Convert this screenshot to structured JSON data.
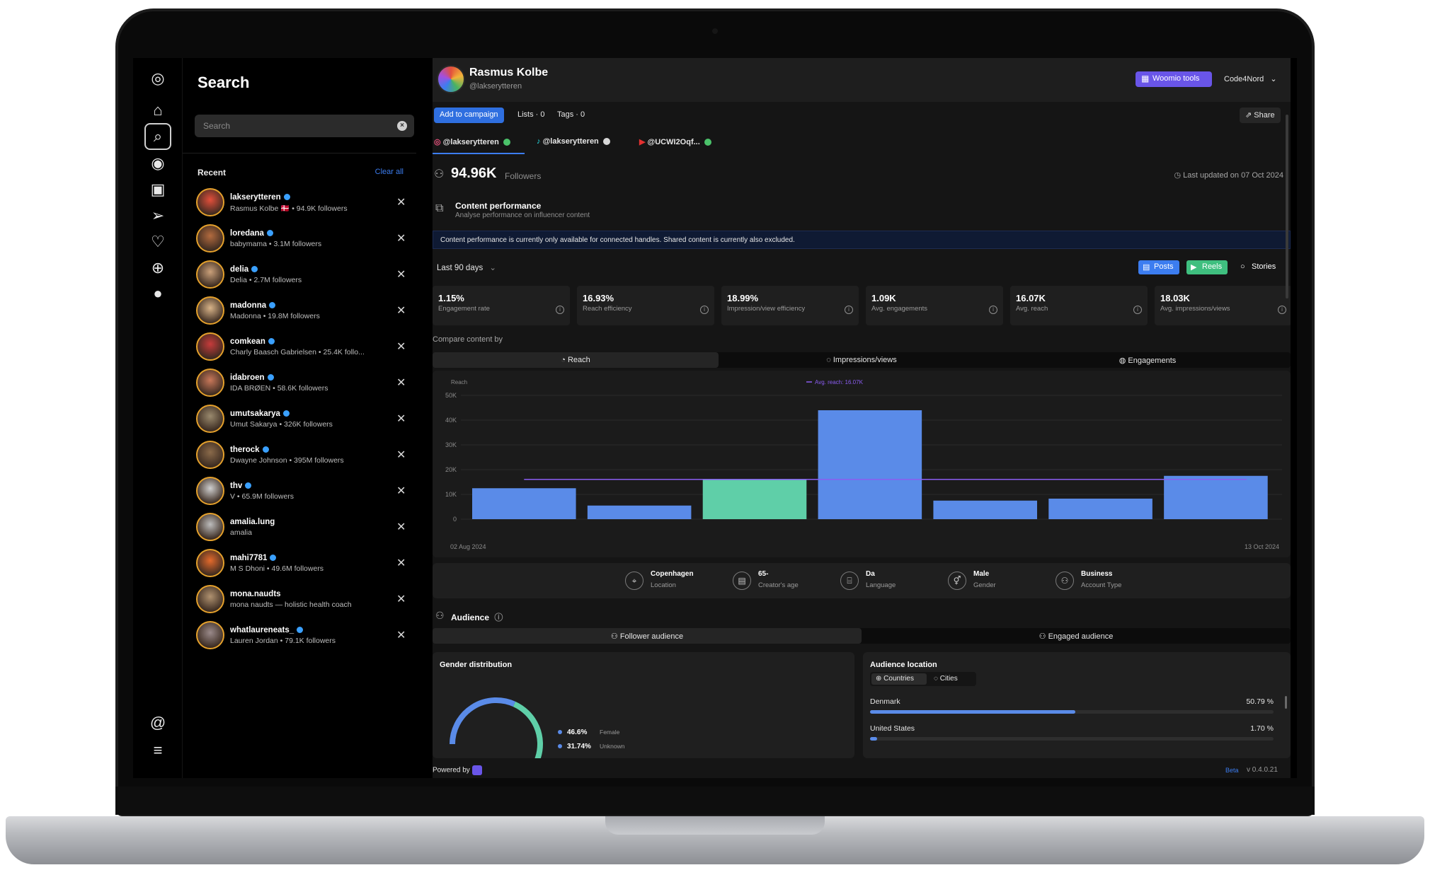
{
  "search": {
    "title": "Search",
    "placeholder": "Search",
    "recent_label": "Recent",
    "clear_all": "Clear all",
    "recent": [
      {
        "name": "lakserytteren",
        "sub": "Rasmus Kolbe 🇩🇰 • 94.9K followers",
        "verified": true,
        "color": "#e34f3b"
      },
      {
        "name": "loredana",
        "sub": "babymama • 3.1M followers",
        "verified": true,
        "color": "#b36b3f"
      },
      {
        "name": "delia",
        "sub": "Delia • 2.7M followers",
        "verified": true,
        "color": "#caa07a"
      },
      {
        "name": "madonna",
        "sub": "Madonna • 19.8M followers",
        "verified": true,
        "color": "#d9b489"
      },
      {
        "name": "comkean",
        "sub": "Charly Baasch Gabrielsen • 25.4K follo...",
        "verified": true,
        "color": "#c63b3b"
      },
      {
        "name": "idabroen",
        "sub": "IDA BRØEN • 58.6K followers",
        "verified": true,
        "color": "#c9785a"
      },
      {
        "name": "umutsakarya",
        "sub": "Umut Sakarya • 326K followers",
        "verified": true,
        "color": "#9a8a6e"
      },
      {
        "name": "therock",
        "sub": "Dwayne Johnson • 395M followers",
        "verified": true,
        "color": "#8a6a4a"
      },
      {
        "name": "thv",
        "sub": "V • 65.9M followers",
        "verified": true,
        "color": "#d0d0d0"
      },
      {
        "name": "amalia.lung",
        "sub": "amalia",
        "verified": false,
        "color": "#bdbdbd"
      },
      {
        "name": "mahi7781",
        "sub": "M S Dhoni • 49.6M followers",
        "verified": true,
        "color": "#e46a2c"
      },
      {
        "name": "mona.naudts",
        "sub": "mona naudts — holistic health coach",
        "verified": false,
        "color": "#b09270"
      },
      {
        "name": "whatlaureneats_",
        "sub": "Lauren Jordan • 79.1K followers",
        "verified": true,
        "color": "#9a8a8a"
      }
    ]
  },
  "profile": {
    "name": "Rasmus Kolbe",
    "handle": "@lakserytteren",
    "woomio_tools": "Woomio tools",
    "org": "Code4Nord"
  },
  "toolbar": {
    "add_campaign": "Add to campaign",
    "lists": "Lists · 0",
    "tags": "Tags · 0",
    "share": "Share"
  },
  "handles": [
    {
      "label": "@lakserytteren",
      "dot": "#4bc26a"
    },
    {
      "label": "@lakserytteren",
      "dot": "#d8d8d8"
    },
    {
      "label": "@UCWI2Oqf...",
      "dot": "#4bc26a"
    }
  ],
  "stats": {
    "followers": "94.96K",
    "followers_label": "Followers",
    "last_updated": "Last updated on 07 Oct 2024"
  },
  "content_performance": {
    "title": "Content performance",
    "subtitle": "Analyse performance on influencer content",
    "banner": "Content performance is currently only available for connected handles. Shared content is currently also excluded.",
    "period": "Last 90 days",
    "types": [
      "Posts",
      "Reels",
      "Stories"
    ]
  },
  "metrics": [
    {
      "value": "1.15%",
      "label": "Engagement rate"
    },
    {
      "value": "16.93%",
      "label": "Reach efficiency"
    },
    {
      "value": "18.99%",
      "label": "Impression/view efficiency"
    },
    {
      "value": "1.09K",
      "label": "Avg. engagements"
    },
    {
      "value": "16.07K",
      "label": "Avg. reach"
    },
    {
      "value": "18.03K",
      "label": "Avg. impressions/views"
    }
  ],
  "compare": {
    "label": "Compare content by",
    "tabs": [
      "Reach",
      "Impressions/views",
      "Engagements"
    ]
  },
  "chart_data": {
    "type": "bar",
    "ylabel": "Reach",
    "ylim": [
      0,
      50000
    ],
    "yticks": [
      "0",
      "10K",
      "20K",
      "30K",
      "40K",
      "50K"
    ],
    "x_start": "02 Aug 2024",
    "x_end": "13 Oct 2024",
    "values": [
      12500,
      5500,
      16000,
      44000,
      7500,
      8300,
      17500
    ],
    "highlight_index": 2,
    "avg_label": "Avg. reach: 16.07K",
    "avg_value": 16070,
    "bar_color": "#5a8be8",
    "highlight_color": "#5fcfa8",
    "avg_color": "#8a5cf0"
  },
  "demographics": [
    {
      "value": "Copenhagen",
      "label": "Location"
    },
    {
      "value": "65-",
      "label": "Creator's age"
    },
    {
      "value": "Da",
      "label": "Language"
    },
    {
      "value": "Male",
      "label": "Gender"
    },
    {
      "value": "Business",
      "label": "Account Type"
    }
  ],
  "audience": {
    "title": "Audience",
    "tabs": [
      "Follower audience",
      "Engaged audience"
    ],
    "gender_title": "Gender distribution",
    "gender": [
      {
        "pct": "46.6%",
        "label": "Female",
        "value": 46.6,
        "color": "#5fcfa8"
      },
      {
        "pct": "31.74%",
        "label": "Unknown",
        "value": 31.74,
        "color": "#5a8be8"
      }
    ],
    "location_title": "Audience location",
    "location_tabs": [
      "Countries",
      "Cities"
    ],
    "locations": [
      {
        "name": "Denmark",
        "pct": "50.79 %",
        "value": 50.79
      },
      {
        "name": "United States",
        "pct": "1.70 %",
        "value": 1.7
      }
    ]
  },
  "footer": {
    "powered_by": "Powered by",
    "beta": "Beta",
    "version": "v 0.4.0.21"
  }
}
